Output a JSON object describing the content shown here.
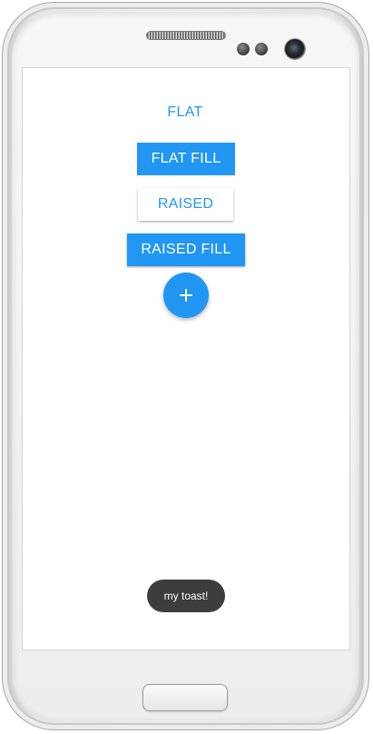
{
  "buttons": {
    "flat_label": "FLAT",
    "flat_fill_label": "FLAT FILL",
    "raised_label": "RAISED",
    "raised_fill_label": "RAISED FILL",
    "fab_icon": "plus-icon"
  },
  "toast": {
    "message": "my toast!"
  },
  "colors": {
    "accent": "#2196F3",
    "toast_background": "#3d3d3d",
    "screen_background": "#ffffff"
  }
}
